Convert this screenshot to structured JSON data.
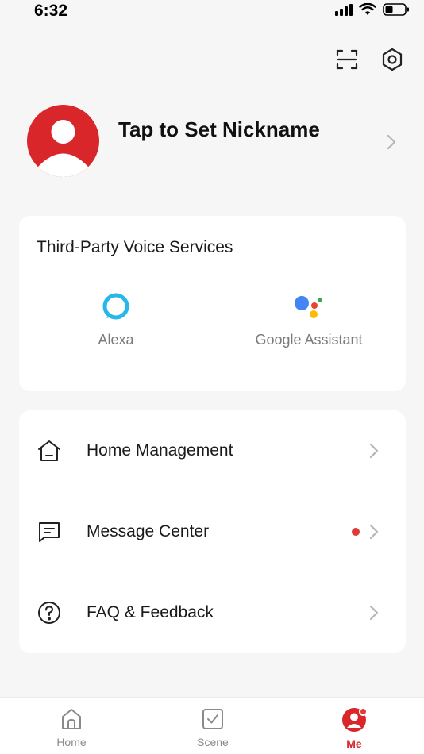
{
  "status_bar": {
    "time": "6:32"
  },
  "header": {
    "scan_icon": "scan-icon",
    "settings_icon": "settings-icon"
  },
  "profile": {
    "nickname": "Tap to Set Nickname"
  },
  "voice_services": {
    "title": "Third-Party Voice Services",
    "items": [
      {
        "label": "Alexa",
        "icon": "alexa-icon"
      },
      {
        "label": "Google Assistant",
        "icon": "google-assistant-icon"
      }
    ]
  },
  "menu": {
    "items": [
      {
        "label": "Home Management",
        "icon": "home-icon"
      },
      {
        "label": "Message Center",
        "icon": "message-icon",
        "has_unread_dot": true
      },
      {
        "label": "FAQ & Feedback",
        "icon": "question-icon"
      }
    ]
  },
  "tab_bar": {
    "tabs": [
      {
        "label": "Home",
        "icon": "home-tab-icon"
      },
      {
        "label": "Scene",
        "icon": "scene-tab-icon"
      },
      {
        "label": "Me",
        "icon": "me-tab-icon",
        "active": true,
        "badge": true
      }
    ]
  },
  "colors": {
    "accent": "#d9262a",
    "background": "#f6f6f6",
    "card": "#ffffff",
    "muted_text": "#7a7a7a",
    "badge": "#e03a3a"
  }
}
